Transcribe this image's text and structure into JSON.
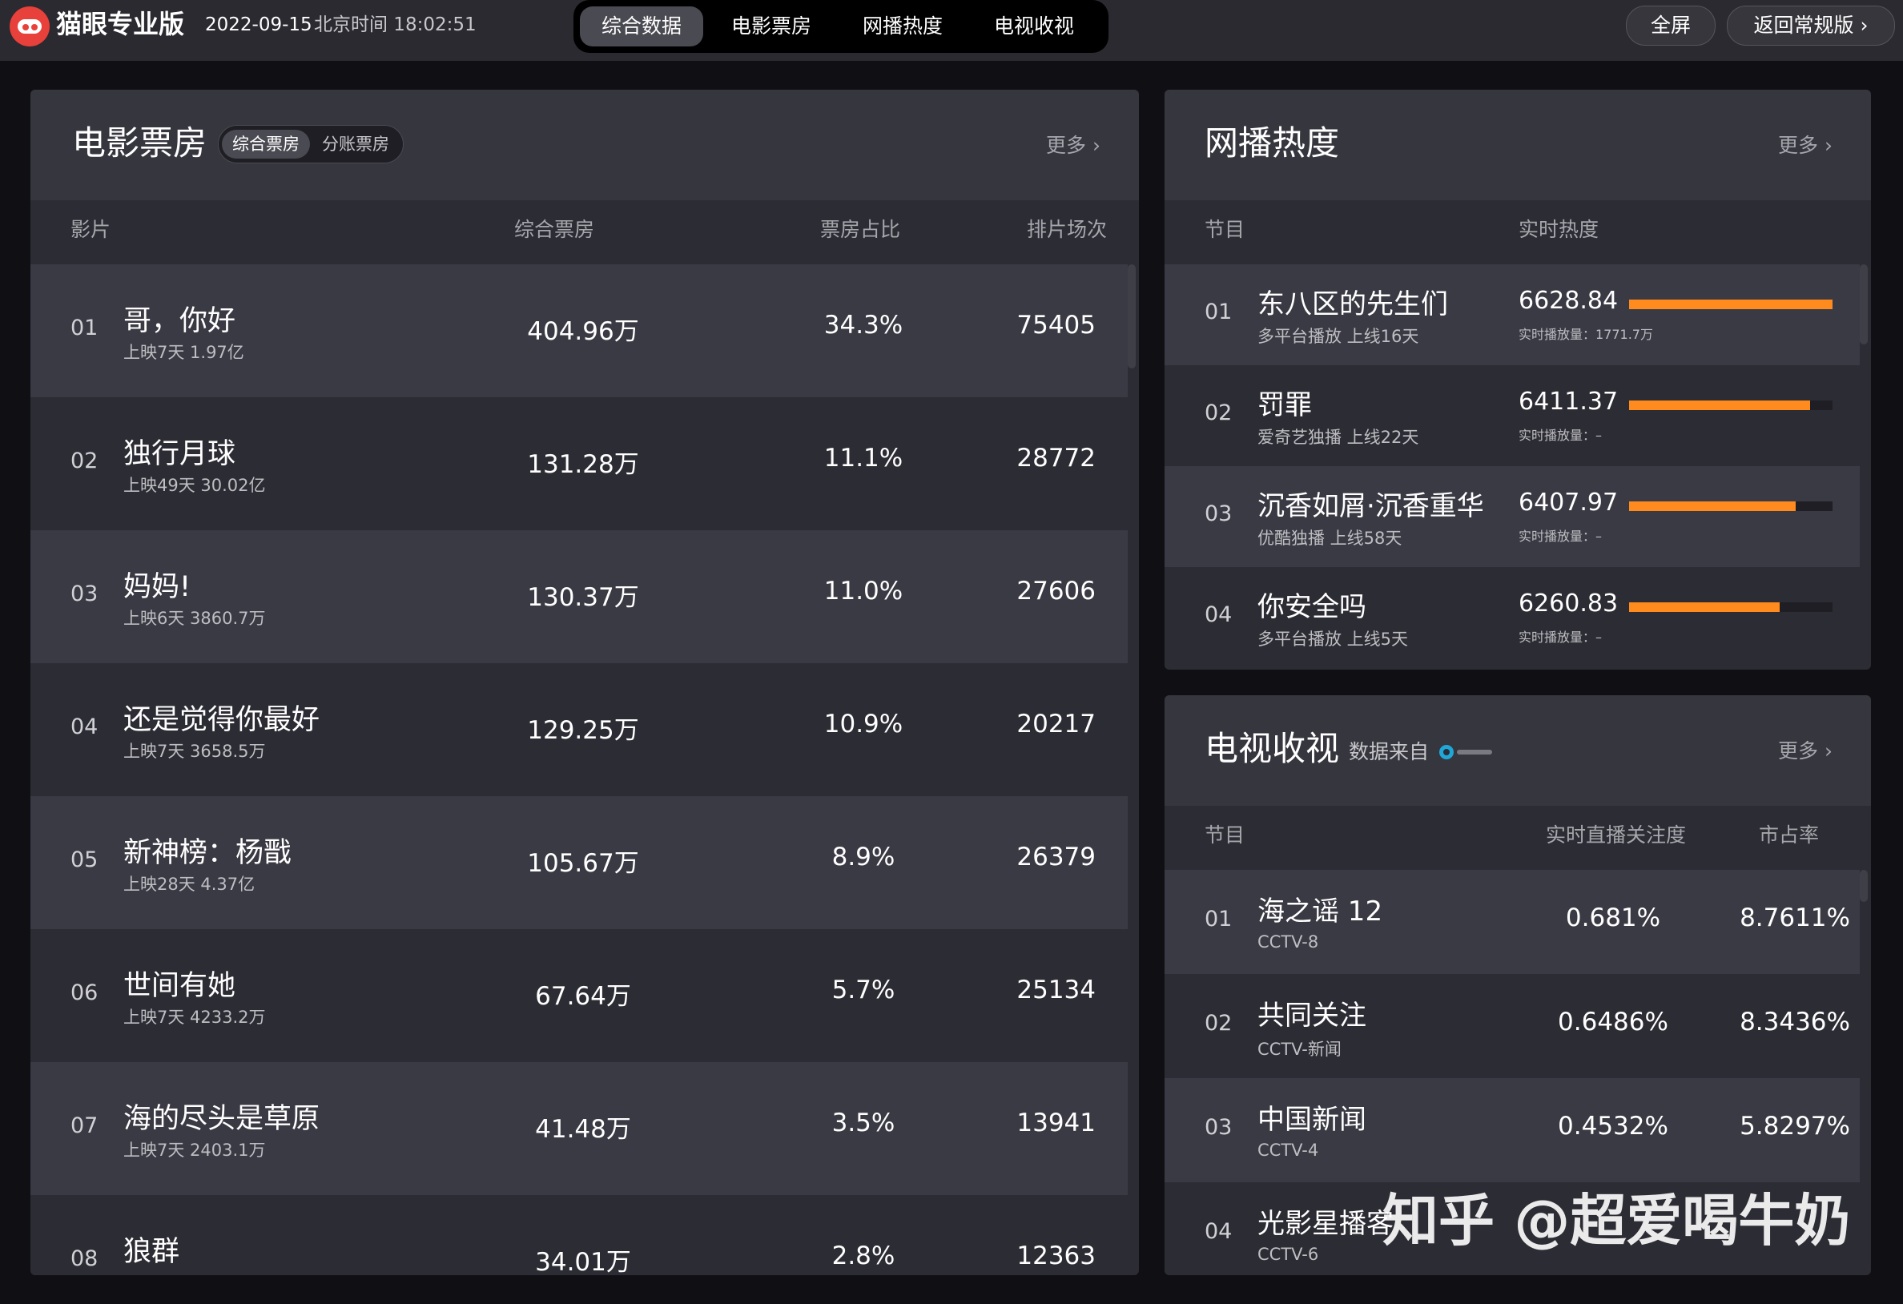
{
  "topbar": {
    "brand": "猫眼专业版",
    "date": "2022-09-15",
    "beijing_time": "北京时间 18:02:51",
    "tabs": [
      "综合数据",
      "电影票房",
      "网播热度",
      "电视收视"
    ],
    "active_tab": "综合数据",
    "fullscreen_label": "全屏",
    "back_label": "返回常规版 ›"
  },
  "boxoffice": {
    "title": "电影票房",
    "toggle": [
      "综合票房",
      "分账票房"
    ],
    "more": "更多 ›",
    "columns": [
      "影片",
      "综合票房",
      "票房占比",
      "排片场次"
    ],
    "rows": [
      {
        "rank": "01",
        "name": "哥，你好",
        "sub": "上映7天  1.97亿",
        "gross": "404.96万",
        "share": "34.3%",
        "shows": "75405"
      },
      {
        "rank": "02",
        "name": "独行月球",
        "sub": "上映49天  30.02亿",
        "gross": "131.28万",
        "share": "11.1%",
        "shows": "28772"
      },
      {
        "rank": "03",
        "name": "妈妈!",
        "sub": "上映6天  3860.7万",
        "gross": "130.37万",
        "share": "11.0%",
        "shows": "27606"
      },
      {
        "rank": "04",
        "name": "还是觉得你最好",
        "sub": "上映7天  3658.5万",
        "gross": "129.25万",
        "share": "10.9%",
        "shows": "20217"
      },
      {
        "rank": "05",
        "name": "新神榜：杨戬",
        "sub": "上映28天  4.37亿",
        "gross": "105.67万",
        "share": "8.9%",
        "shows": "26379"
      },
      {
        "rank": "06",
        "name": "世间有她",
        "sub": "上映7天  4233.2万",
        "gross": "67.64万",
        "share": "5.7%",
        "shows": "25134"
      },
      {
        "rank": "07",
        "name": "海的尽头是草原",
        "sub": "上映7天  2403.1万",
        "gross": "41.48万",
        "share": "3.5%",
        "shows": "13941"
      },
      {
        "rank": "08",
        "name": "狼群",
        "sub": "",
        "gross": "34.01万",
        "share": "2.8%",
        "shows": "12363"
      }
    ]
  },
  "web": {
    "title": "网播热度",
    "more": "更多 ›",
    "columns": [
      "节目",
      "实时热度"
    ],
    "rows": [
      {
        "rank": "01",
        "name": "东八区的先生们",
        "sub": "多平台播放  上线16天",
        "heat": "6628.84",
        "plays": "实时播放量：1771.7万",
        "level": 1.0
      },
      {
        "rank": "02",
        "name": "罚罪",
        "sub": "爱奇艺独播  上线22天",
        "heat": "6411.37",
        "plays": "实时播放量：–",
        "level": 0.89
      },
      {
        "rank": "03",
        "name": "沉香如屑·沉香重华",
        "sub": "优酷独播  上线58天",
        "heat": "6407.97",
        "plays": "实时播放量：–",
        "level": 0.82
      },
      {
        "rank": "04",
        "name": "你安全吗",
        "sub": "多平台播放  上线5天",
        "heat": "6260.83",
        "plays": "实时播放量：–",
        "level": 0.74
      }
    ]
  },
  "tv": {
    "title": "电视收视",
    "source": "数据来自",
    "more": "更多 ›",
    "columns": [
      "节目",
      "实时直播关注度",
      "市占率"
    ],
    "rows": [
      {
        "rank": "01",
        "name": "海之谣 12",
        "sub": "CCTV-8",
        "attention": "0.681%",
        "share": "8.7611%"
      },
      {
        "rank": "02",
        "name": "共同关注",
        "sub": "CCTV-新闻",
        "attention": "0.6486%",
        "share": "8.3436%"
      },
      {
        "rank": "03",
        "name": "中国新闻",
        "sub": "CCTV-4",
        "attention": "0.4532%",
        "share": "5.8297%"
      },
      {
        "rank": "04",
        "name": "光影星播客",
        "sub": "CCTV-6",
        "attention": "",
        "share": ""
      }
    ]
  },
  "watermark": "知乎 @超爱喝牛奶",
  "colors": {
    "accent": "#ff8a1e",
    "panel": "#2c2c34",
    "row_alt": "#36363f",
    "bg": "#101014"
  }
}
